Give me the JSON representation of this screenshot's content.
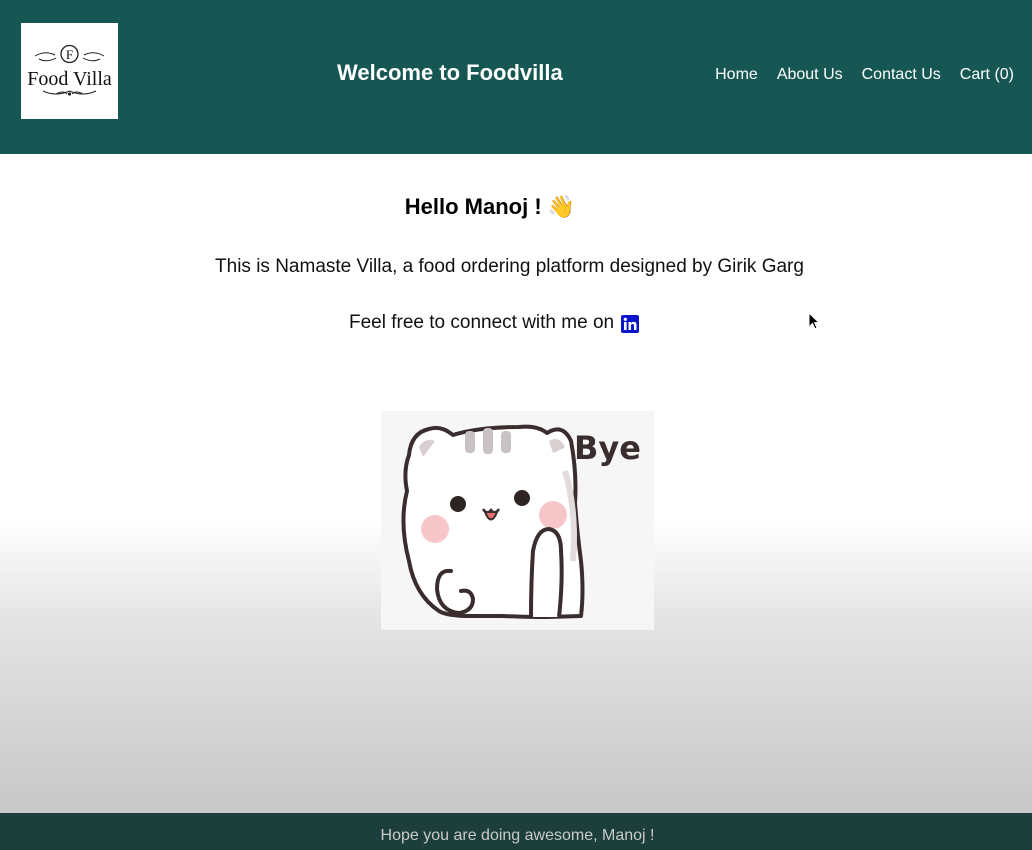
{
  "header": {
    "logo_letter": "F",
    "logo_text": "Food Villa",
    "title": "Welcome to Foodvilla",
    "nav": {
      "home": "Home",
      "about": "About Us",
      "contact": "Contact Us",
      "cart": "Cart (0)"
    },
    "background_color": "#165753"
  },
  "main": {
    "greeting": "Hello Manoj !",
    "greeting_emoji": "👋",
    "intro": "This is Namaste Villa, a food ordering platform designed by Girik Garg",
    "connect_text": "Feel free to connect with me on",
    "connect_icon": "linkedin-icon",
    "sticker": {
      "caption": "Bye",
      "icon": "cat-waving-sticker"
    }
  },
  "footer": {
    "text": "Hope you are doing awesome, Manoj !",
    "background_color": "#1c3f3b"
  }
}
